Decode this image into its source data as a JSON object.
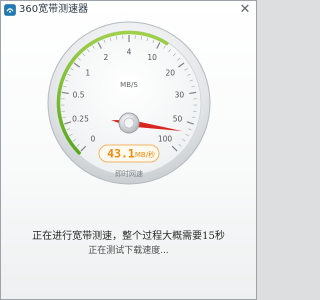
{
  "window": {
    "title": "360宽带测速器",
    "close_symbol": "✕",
    "icon": "360-broadband-icon",
    "accent_color": "#1f7ab5"
  },
  "gauge": {
    "unit_label": "MB/S",
    "scale_labels": [
      "0",
      "0.25",
      "0.5",
      "1",
      "2",
      "4",
      "10",
      "20",
      "30",
      "50",
      "100"
    ],
    "needle_value": 43.1,
    "speed_value": "43.1",
    "speed_unit": "MB/秒",
    "realtime_label": "即时网速",
    "needle_color": "#d8251d",
    "readout_color": "#f08a0c",
    "arc_colors": [
      "#9fd04a",
      "#59a81c"
    ]
  },
  "status": {
    "main_text": "正在进行宽带测速，整个过程大概需要15秒",
    "sub_text": "正在测试下载速度..."
  }
}
